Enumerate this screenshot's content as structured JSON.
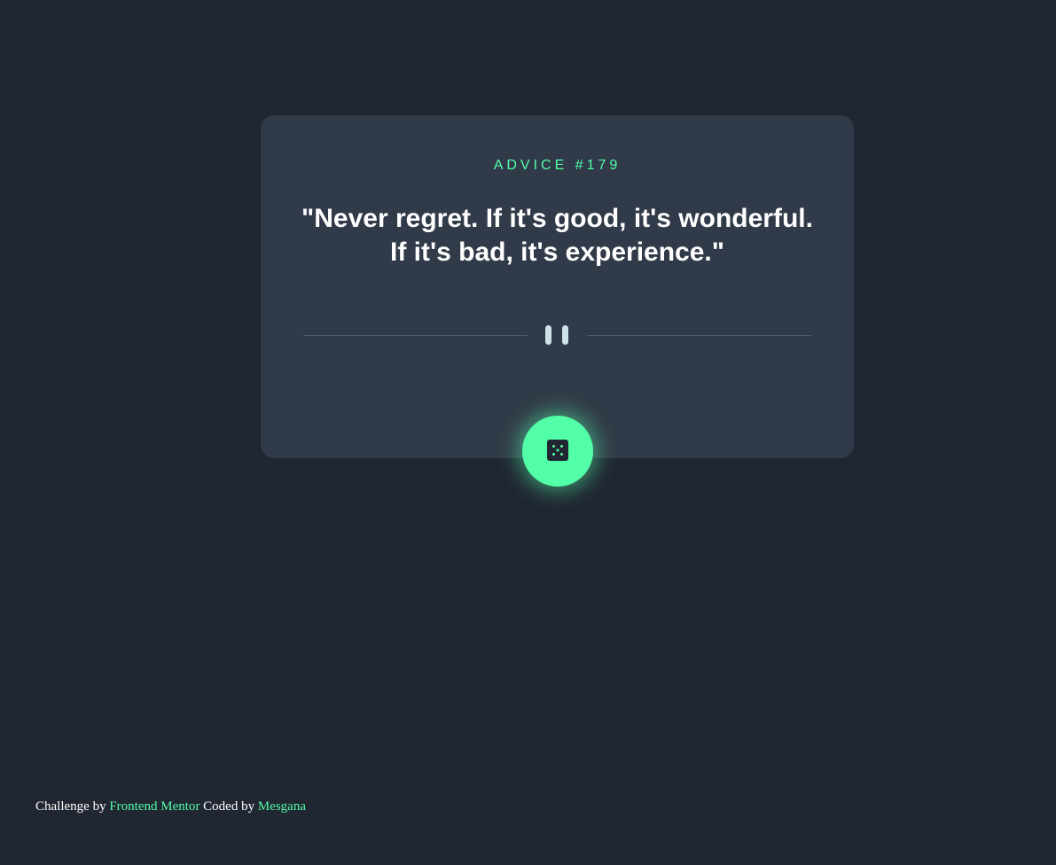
{
  "card": {
    "advice_label": "ADVICE #179",
    "advice_text": "\"Never regret. If it's good, it's wonderful. If it's bad, it's experience.\""
  },
  "dice_button": {
    "icon": "dice-icon"
  },
  "footer": {
    "prefix": "Challenge by",
    "challenge_link": "Frontend Mentor",
    "middle": "Coded by",
    "author_link": "Mesgana"
  },
  "colors": {
    "background": "#202632",
    "card": "#313a48",
    "accent": "#52ffa8",
    "text": "#ffffff",
    "divider": "#4f5d74",
    "pause": "#cee3e9"
  }
}
